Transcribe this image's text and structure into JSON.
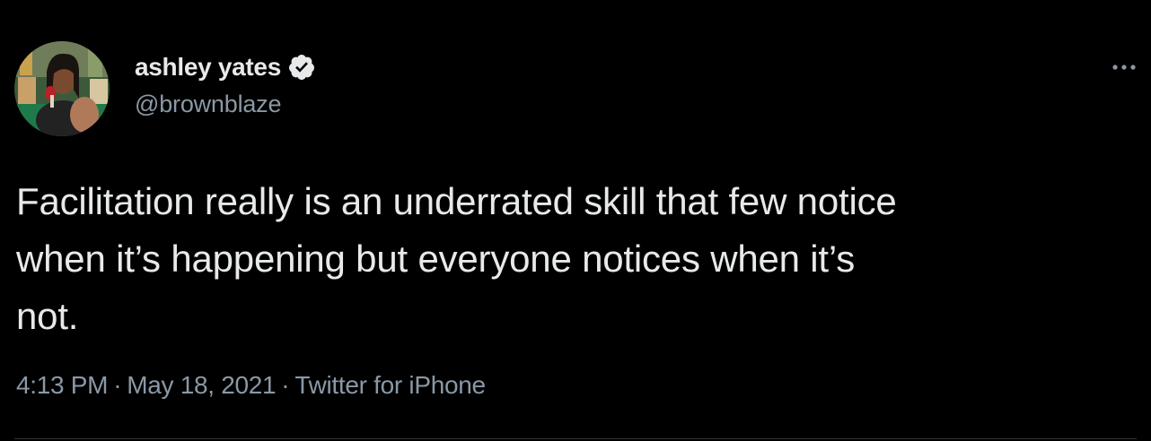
{
  "tweet": {
    "author": {
      "display_name": "ashley yates",
      "handle": "@brownblaze",
      "verified": true,
      "verified_icon": "verified-badge-icon",
      "avatar_icon": "profile-photo"
    },
    "more_icon": "more-options-icon",
    "text_lines": [
      "Facilitation really is an underrated skill that few notice",
      "when it’s happening but everyone notices when it’s",
      "not."
    ],
    "meta": {
      "time": "4:13 PM",
      "separator": "·",
      "date": "May 18, 2021",
      "source": "Twitter for iPhone"
    }
  },
  "colors": {
    "background": "#000000",
    "primary_text": "#e7e9ea",
    "secondary_text": "#8b98a5",
    "verified_badge": "#e7e9ea"
  }
}
